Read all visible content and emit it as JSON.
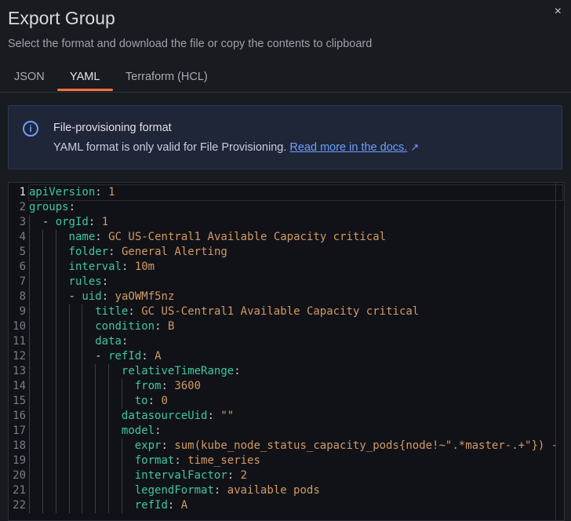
{
  "dialog": {
    "title": "Export Group",
    "subtitle": "Select the format and download the file or copy the contents to clipboard",
    "close_icon": "×"
  },
  "tabs": [
    {
      "label": "JSON"
    },
    {
      "label": "YAML",
      "active": true
    },
    {
      "label": "Terraform (HCL)"
    }
  ],
  "alert": {
    "title": "File-provisioning format",
    "body": "YAML format is only valid for File Provisioning.",
    "link": "Read more in the docs.",
    "accent": "#6e9fff"
  },
  "code": [
    {
      "i": 0,
      "k": "apiVersion",
      "v": "1"
    },
    {
      "i": 0,
      "k": "groups",
      "v": ""
    },
    {
      "i": 2,
      "dash": true,
      "k": "orgId",
      "v": "1"
    },
    {
      "i": 6,
      "k": "name",
      "v": "GC US-Central1 Available Capacity critical"
    },
    {
      "i": 6,
      "k": "folder",
      "v": "General Alerting"
    },
    {
      "i": 6,
      "k": "interval",
      "v": "10m"
    },
    {
      "i": 6,
      "k": "rules",
      "v": ""
    },
    {
      "i": 6,
      "dash": true,
      "k": "uid",
      "v": "yaOWMf5nz"
    },
    {
      "i": 10,
      "k": "title",
      "v": "GC US-Central1 Available Capacity critical"
    },
    {
      "i": 10,
      "k": "condition",
      "v": "B"
    },
    {
      "i": 10,
      "k": "data",
      "v": ""
    },
    {
      "i": 10,
      "dash": true,
      "k": "refId",
      "v": "A"
    },
    {
      "i": 14,
      "k": "relativeTimeRange",
      "v": ""
    },
    {
      "i": 16,
      "k": "from",
      "v": "3600"
    },
    {
      "i": 16,
      "k": "to",
      "v": "0"
    },
    {
      "i": 14,
      "k": "datasourceUid",
      "v": "\"\""
    },
    {
      "i": 14,
      "k": "model",
      "v": ""
    },
    {
      "i": 16,
      "k": "expr",
      "v": "sum(kube_node_status_capacity_pods{node!~\".*master-.+\"}) -"
    },
    {
      "i": 16,
      "k": "format",
      "v": "time_series"
    },
    {
      "i": 16,
      "k": "intervalFactor",
      "v": "2"
    },
    {
      "i": 16,
      "k": "legendFormat",
      "v": "available pods"
    },
    {
      "i": 16,
      "k": "refId",
      "v": "A"
    }
  ]
}
